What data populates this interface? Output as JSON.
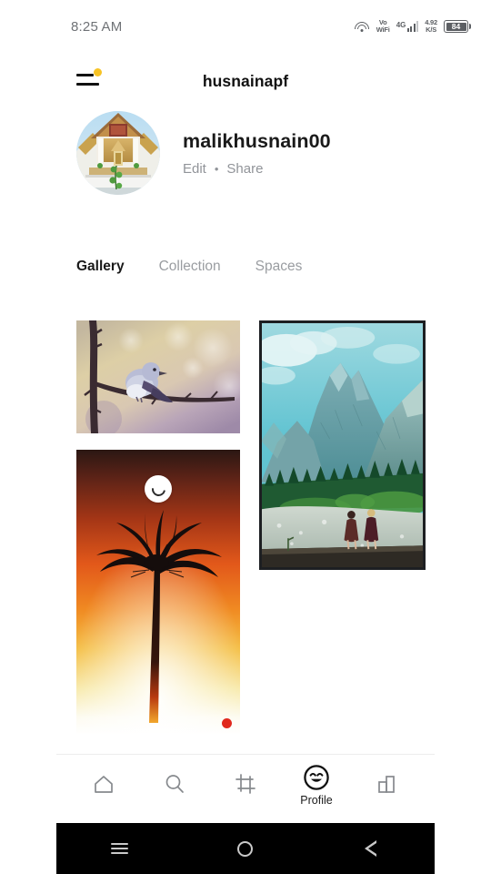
{
  "statusbar": {
    "time": "8:25 AM",
    "vo_label": "Vo",
    "wifi_label": "WiFi",
    "network": "4G",
    "datarate_value": "4.92",
    "datarate_unit": "K/S",
    "battery": "84",
    "wifi_icon": "wifi-icon",
    "signal_icon": "signal-bars-icon",
    "battery_icon": "battery-icon"
  },
  "header": {
    "title": "husnainapf",
    "menu_icon": "hamburger-menu-icon",
    "badge_color": "#f7c325"
  },
  "profile": {
    "avatar_alt": "temple-photo-avatar",
    "name": "malikhusnain00",
    "edit_label": "Edit",
    "separator": "•",
    "share_label": "Share"
  },
  "tabs": [
    {
      "label": "Gallery",
      "active": true
    },
    {
      "label": "Collection",
      "active": false
    },
    {
      "label": "Spaces",
      "active": false
    }
  ],
  "gallery": {
    "tiles": [
      {
        "name": "bird-on-branch-photo",
        "column": "left"
      },
      {
        "name": "palm-tree-sunset-photo",
        "column": "left",
        "spinner": true,
        "red_dot": true
      },
      {
        "name": "mountain-landscape-photo",
        "column": "right"
      }
    ],
    "spinner_icon": "refresh-spinner-icon",
    "red_dot_color": "#e0281d"
  },
  "bottomnav": {
    "items": [
      {
        "name": "home",
        "icon": "home-icon",
        "label": "",
        "active": false
      },
      {
        "name": "search",
        "icon": "search-icon",
        "label": "",
        "active": false
      },
      {
        "name": "crop",
        "icon": "crop-frame-icon",
        "label": "",
        "active": false
      },
      {
        "name": "profile",
        "icon": "smiley-face-icon",
        "label": "Profile",
        "active": true
      },
      {
        "name": "stats",
        "icon": "bar-chart-icon",
        "label": "",
        "active": false
      }
    ]
  },
  "sysbar": {
    "recents_icon": "recents-icon",
    "home_icon": "home-circle-icon",
    "back_icon": "back-triangle-icon"
  }
}
